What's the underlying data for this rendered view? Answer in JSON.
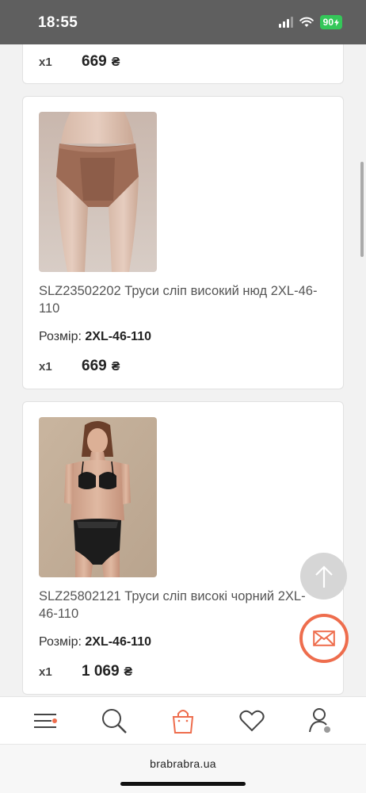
{
  "status_bar": {
    "time": "18:55",
    "battery": "90"
  },
  "cart_items": [
    {
      "qty": "x1",
      "price": "669",
      "currency": "₴"
    },
    {
      "name": "SLZ23502202 Труси сліп високий нюд 2XL-46-110",
      "size_label": "Розмір:",
      "size_value": "2XL-46-110",
      "qty": "x1",
      "price": "669",
      "currency": "₴",
      "image": "product-nude-briefs"
    },
    {
      "name": "SLZ25802121 Труси сліп високі чорний 2XL-46-110",
      "size_label": "Розмір:",
      "size_value": "2XL-46-110",
      "qty": "x1",
      "price": "1 069",
      "currency": "₴",
      "image": "product-black-lingerie"
    }
  ],
  "fab": {
    "up_icon": "arrow-up-icon",
    "mail_icon": "envelope-icon",
    "mail_color": "#ee6d4d"
  },
  "bottom_nav": {
    "items": [
      {
        "icon": "menu-icon"
      },
      {
        "icon": "search-icon"
      },
      {
        "icon": "cart-bag-icon",
        "active_color": "#ee6d4d"
      },
      {
        "icon": "heart-icon"
      },
      {
        "icon": "user-icon"
      }
    ]
  },
  "browser": {
    "url": "brabrabra.ua"
  }
}
